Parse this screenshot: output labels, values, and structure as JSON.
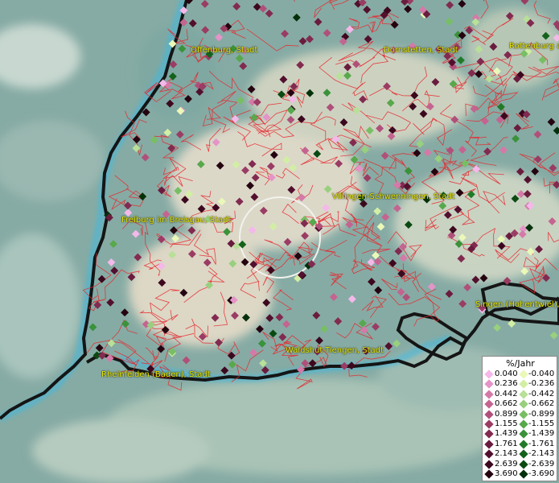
{
  "map": {
    "cities": [
      {
        "name": "Offenburg, Stadt"
      },
      {
        "name": "Dornstetten, Stadt"
      },
      {
        "name": "Rottenburg a"
      },
      {
        "name": "Villingen-Schwenningen, Stadt"
      },
      {
        "name": "Freiburg im Breisgau, Stadt"
      },
      {
        "name": "Singen (Hohentwiel),"
      },
      {
        "name": "Waldshut-Tiengen, Stadt"
      },
      {
        "name": "Rheinfelden (Baden), Stadt"
      }
    ]
  },
  "legend": {
    "title": "%/Jahr",
    "rows": [
      {
        "pos": "0.040",
        "neg": "-0.040",
        "pos_color": "#f4b8ea",
        "neg_color": "#eaf8b8"
      },
      {
        "pos": "0.236",
        "neg": "-0.236",
        "pos_color": "#e494c8",
        "neg_color": "#d2eea4"
      },
      {
        "pos": "0.442",
        "neg": "-0.442",
        "pos_color": "#d47aa8",
        "neg_color": "#b8e098"
      },
      {
        "pos": "0.662",
        "neg": "-0.662",
        "pos_color": "#c46490",
        "neg_color": "#98d07e"
      },
      {
        "pos": "0.899",
        "neg": "-0.899",
        "pos_color": "#b0507a",
        "neg_color": "#78be64"
      },
      {
        "pos": "1.155",
        "neg": "-1.155",
        "pos_color": "#9a3c64",
        "neg_color": "#58a84c"
      },
      {
        "pos": "1.439",
        "neg": "-1.439",
        "pos_color": "#822a50",
        "neg_color": "#3a923a"
      },
      {
        "pos": "1.761",
        "neg": "-1.761",
        "pos_color": "#6a1c3e",
        "neg_color": "#227a28"
      },
      {
        "pos": "2.143",
        "neg": "-2.143",
        "pos_color": "#52102e",
        "neg_color": "#14621c"
      },
      {
        "pos": "2.639",
        "neg": "-2.639",
        "pos_color": "#3c081e",
        "neg_color": "#0a4a12"
      },
      {
        "pos": "3.690",
        "neg": "-3.690",
        "pos_color": "#240410",
        "neg_color": "#04300a"
      }
    ]
  }
}
